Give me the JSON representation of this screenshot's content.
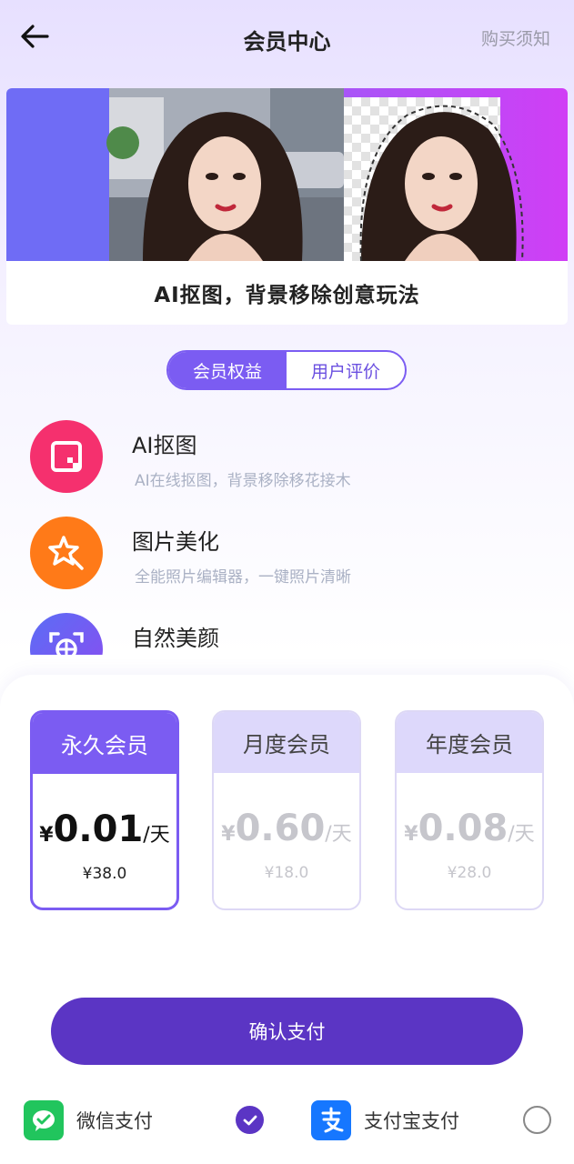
{
  "header": {
    "title": "会员中心",
    "notice_label": "购买须知",
    "back_icon": "arrow-left-icon"
  },
  "banner": {
    "caption": "AI抠图，背景移除创意玩法"
  },
  "tabs": [
    {
      "label": "会员权益",
      "active": true
    },
    {
      "label": "用户评价",
      "active": false
    }
  ],
  "features": [
    {
      "title": "AI抠图",
      "desc": "AI在线抠图，背景移除移花接木",
      "icon": "cutout-icon",
      "color": "#f5306e"
    },
    {
      "title": "图片美化",
      "desc": "全能照片编辑器，一键照片清晰",
      "icon": "magic-star-icon",
      "color": "#ff7a18"
    },
    {
      "title": "自然美颜",
      "desc": "",
      "icon": "face-scan-icon",
      "color": "#5b6df5"
    }
  ],
  "plans": [
    {
      "name": "永久会员",
      "currency": "¥",
      "price": "0.01",
      "unit": "/天",
      "total": "¥38.0",
      "selected": true
    },
    {
      "name": "月度会员",
      "currency": "¥",
      "price": "0.60",
      "unit": "/天",
      "total": "¥18.0",
      "selected": false
    },
    {
      "name": "年度会员",
      "currency": "¥",
      "price": "0.08",
      "unit": "/天",
      "total": "¥28.0",
      "selected": false
    }
  ],
  "confirm_label": "确认支付",
  "payment": {
    "wechat": {
      "label": "微信支付",
      "selected": true,
      "color": "#21c55d",
      "icon": "wechat-pay-icon"
    },
    "alipay": {
      "label": "支付宝支付",
      "selected": false,
      "color": "#1677ff",
      "icon": "alipay-icon"
    }
  },
  "colors": {
    "accent": "#7b5cf2",
    "button": "#5b35c4"
  }
}
